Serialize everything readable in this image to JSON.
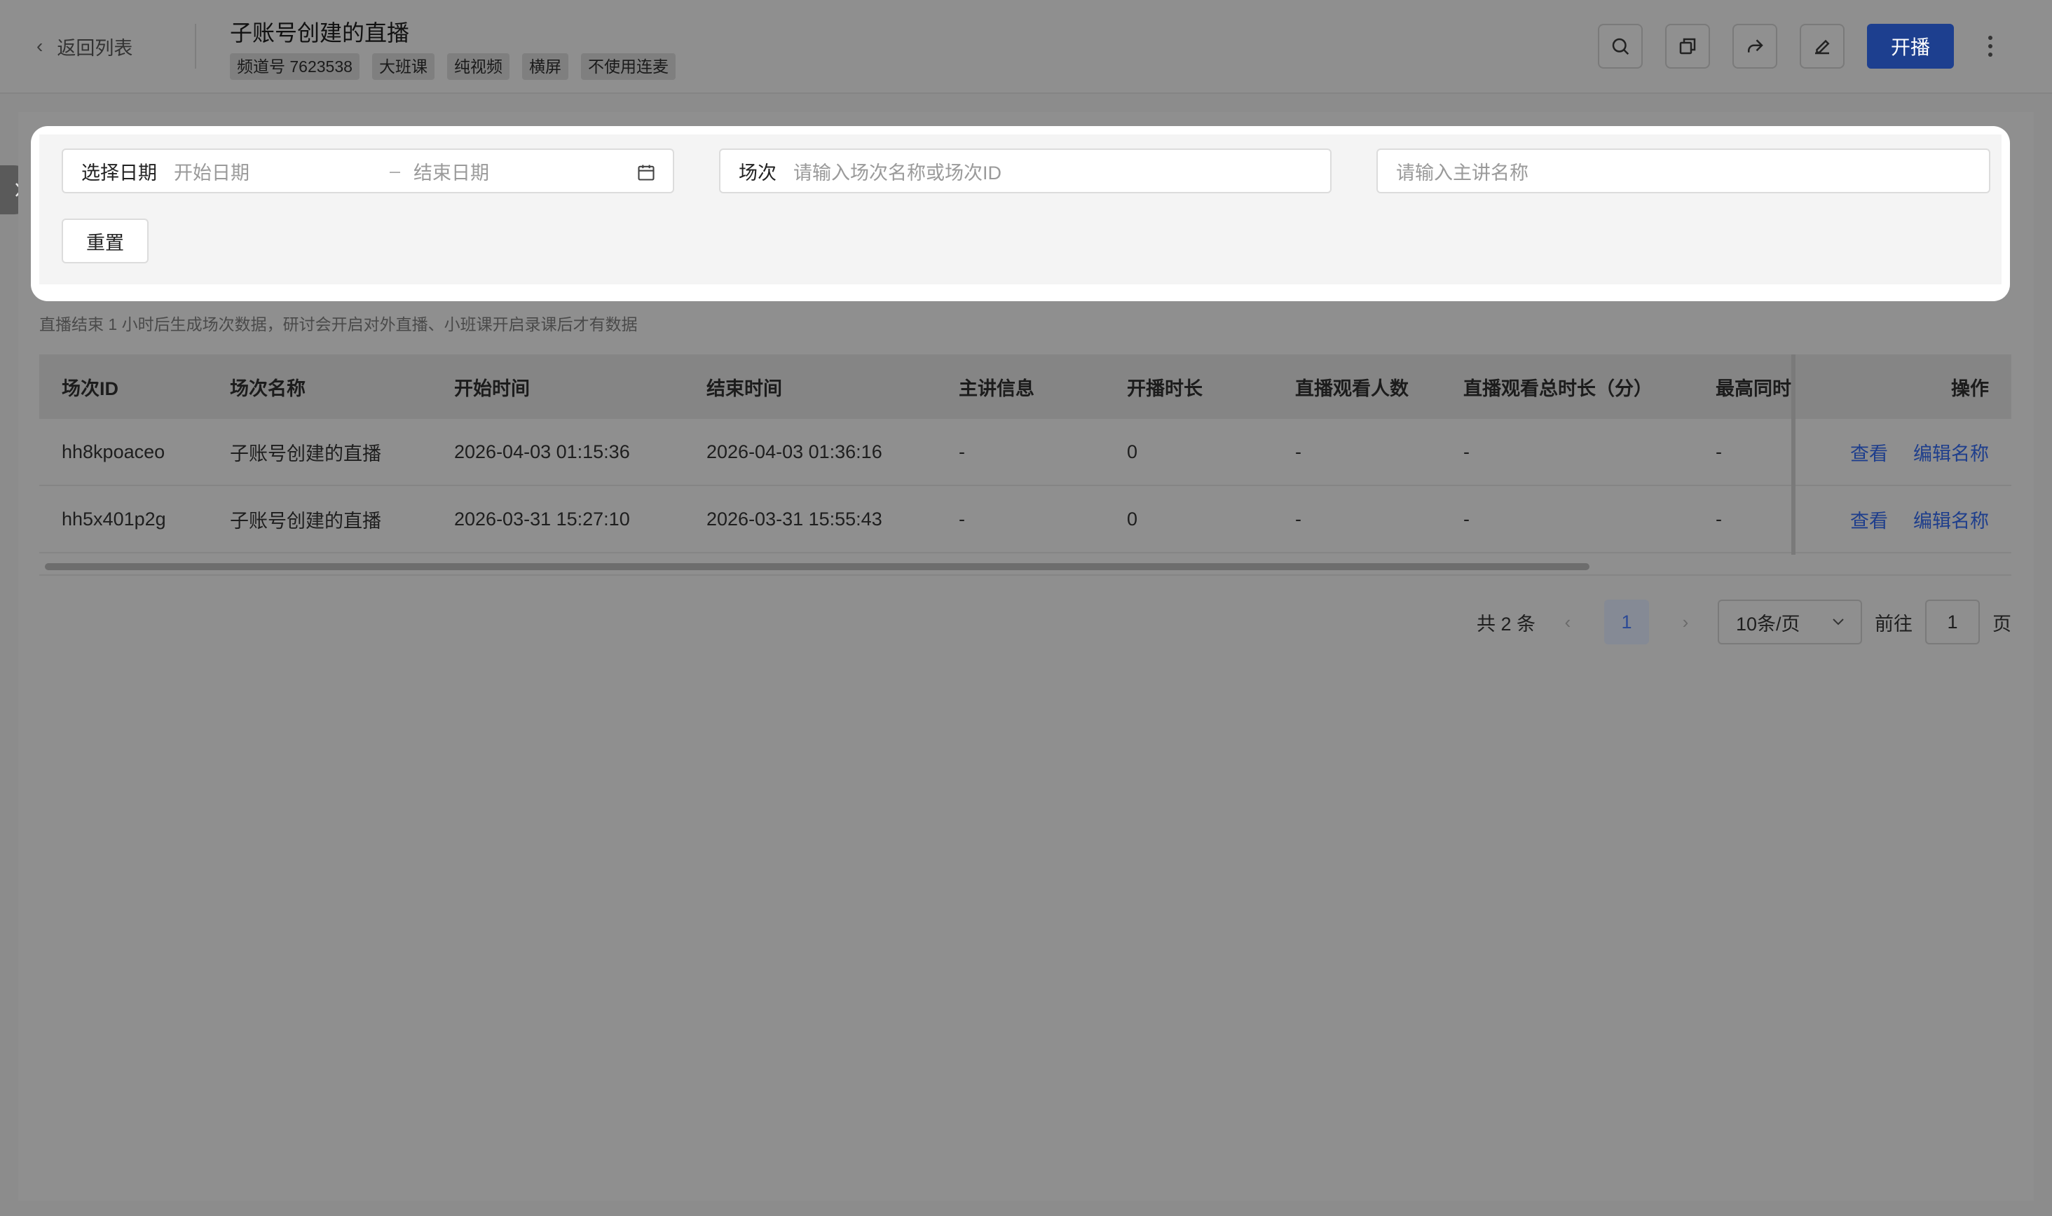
{
  "header": {
    "back_label": "返回列表",
    "title": "子账号创建的直播",
    "tags": [
      "频道号 7623538",
      "大班课",
      "纯视频",
      "横屏",
      "不使用连麦"
    ],
    "live_button": "开播"
  },
  "filters": {
    "date_label": "选择日期",
    "start_placeholder": "开始日期",
    "range_separator": "–",
    "end_placeholder": "结束日期",
    "session_label": "场次",
    "session_placeholder": "请输入场次名称或场次ID",
    "host_placeholder": "请输入主讲名称",
    "reset_label": "重置"
  },
  "notice": "直播结束 1 小时后生成场次数据，研讨会开启对外直播、小班课开启录课后才有数据",
  "table": {
    "columns": [
      "场次ID",
      "场次名称",
      "开始时间",
      "结束时间",
      "主讲信息",
      "开播时长",
      "直播观看人数",
      "直播观看总时长（分）",
      "最高同时",
      "操作"
    ],
    "rows": [
      {
        "id": "hh8kpoaceo",
        "name": "子账号创建的直播",
        "start": "2026-04-03 01:15:36",
        "end": "2026-04-03 01:36:16",
        "host": "-",
        "duration": "0",
        "viewers": "-",
        "watch_total": "-",
        "peak": "-",
        "view": "查看",
        "edit": "编辑名称"
      },
      {
        "id": "hh5x401p2g",
        "name": "子账号创建的直播",
        "start": "2026-03-31 15:27:10",
        "end": "2026-03-31 15:55:43",
        "host": "-",
        "duration": "0",
        "viewers": "-",
        "watch_total": "-",
        "peak": "-",
        "view": "查看",
        "edit": "编辑名称"
      }
    ]
  },
  "pagination": {
    "total": "共 2 条",
    "prev": "‹",
    "current": "1",
    "next": "›",
    "page_size": "10条/页",
    "goto_label": "前往",
    "goto_value": "1",
    "page_unit": "页"
  }
}
